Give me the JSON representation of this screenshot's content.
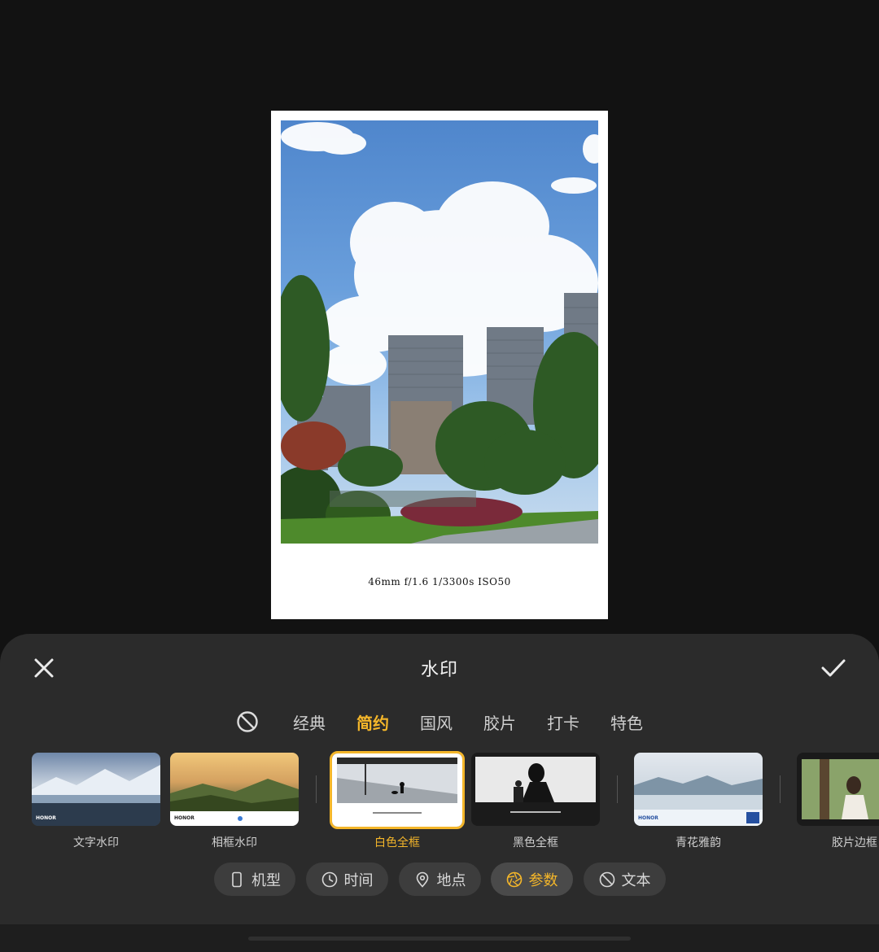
{
  "preview": {
    "exif_text": "46mm  f/1.6  1/3300s  ISO50"
  },
  "panel": {
    "title": "水印",
    "close_icon": "close-icon",
    "confirm_icon": "check-icon"
  },
  "tabs": [
    {
      "label": "经典",
      "active": false
    },
    {
      "label": "简约",
      "active": true
    },
    {
      "label": "国风",
      "active": false
    },
    {
      "label": "胶片",
      "active": false
    },
    {
      "label": "打卡",
      "active": false
    },
    {
      "label": "特色",
      "active": false
    }
  ],
  "thumbnails": [
    {
      "label": "文字水印",
      "brand": "HONOR",
      "selected": false
    },
    {
      "label": "相框水印",
      "brand": "HONOR",
      "selected": false
    },
    {
      "label": "白色全框",
      "selected": true
    },
    {
      "label": "黑色全框",
      "selected": false
    },
    {
      "label": "青花雅韵",
      "brand": "HONOR",
      "selected": false
    },
    {
      "label": "胶片边框",
      "selected": false
    }
  ],
  "chips": [
    {
      "label": "机型",
      "icon": "phone-icon",
      "active": false
    },
    {
      "label": "时间",
      "icon": "clock-icon",
      "active": false
    },
    {
      "label": "地点",
      "icon": "location-pin-icon",
      "active": false
    },
    {
      "label": "参数",
      "icon": "aperture-icon",
      "active": true
    },
    {
      "label": "文本",
      "icon": "no-text-icon",
      "active": false
    }
  ],
  "colors": {
    "accent": "#f4b62a",
    "panel": "#2b2b2b",
    "background": "#121212"
  }
}
